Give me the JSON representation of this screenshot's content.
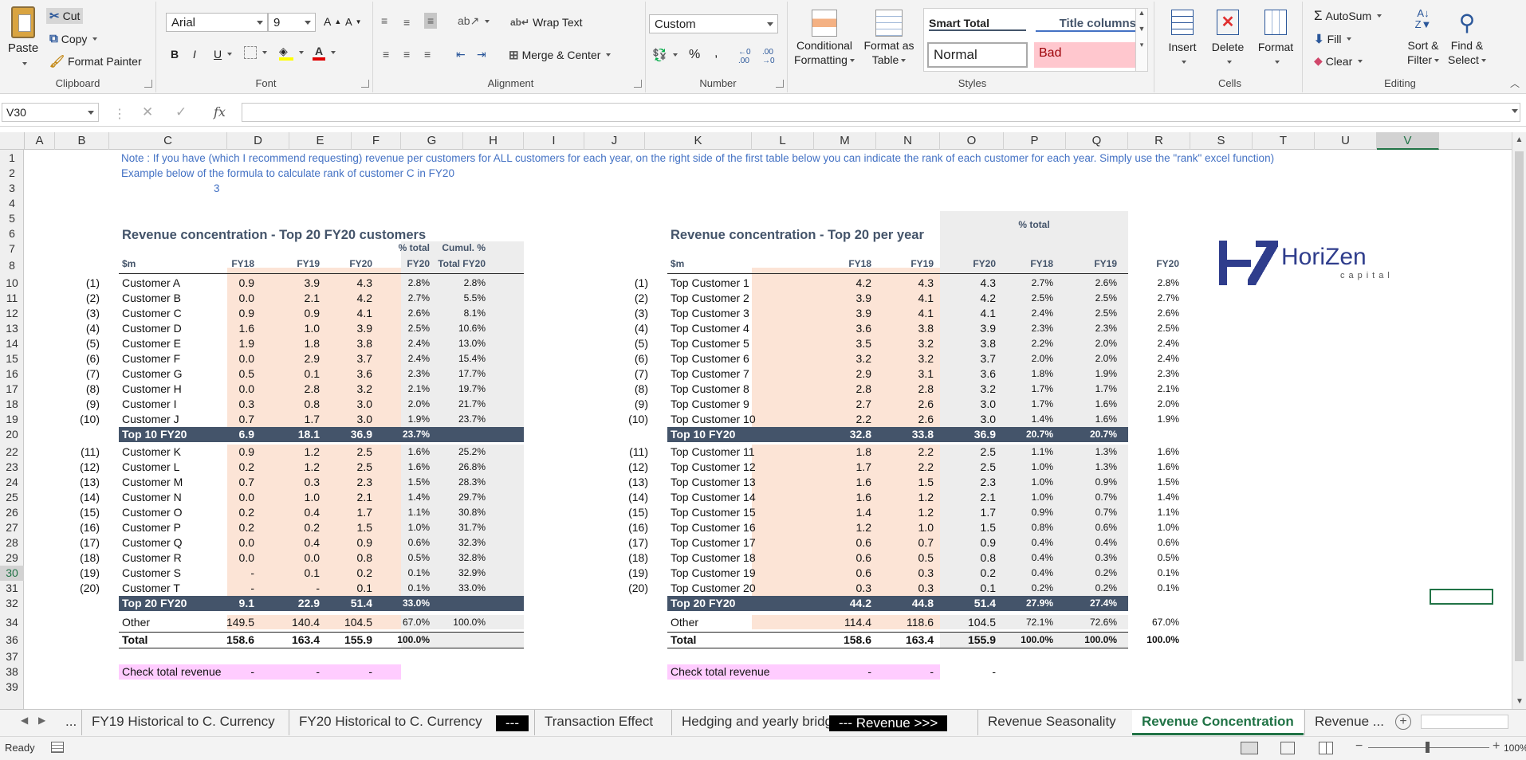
{
  "ribbon": {
    "clipboard": {
      "label": "Clipboard",
      "paste": "Paste",
      "cut": "Cut",
      "copy": "Copy",
      "format_painter": "Format Painter"
    },
    "font": {
      "label": "Font",
      "name": "Arial",
      "size": "9"
    },
    "alignment": {
      "label": "Alignment",
      "wrap": "Wrap Text",
      "merge": "Merge & Center"
    },
    "number": {
      "label": "Number",
      "format": "Custom"
    },
    "styles": {
      "label": "Styles",
      "cond1": "Conditional",
      "cond2": "Formatting",
      "fmt1": "Format as",
      "fmt2": "Table",
      "smart_total": "Smart Total",
      "title_columns": "Title columns",
      "normal": "Normal",
      "bad": "Bad"
    },
    "cells": {
      "label": "Cells",
      "insert": "Insert",
      "delete": "Delete",
      "format": "Format"
    },
    "editing": {
      "label": "Editing",
      "autosum": "AutoSum",
      "fill": "Fill",
      "clear": "Clear",
      "sort1": "Sort &",
      "sort2": "Filter",
      "find1": "Find &",
      "find2": "Select"
    }
  },
  "formula_bar": {
    "name_box": "V30",
    "fx": "fx",
    "content": ""
  },
  "columns": [
    "A",
    "B",
    "C",
    "D",
    "E",
    "F",
    "G",
    "H",
    "I",
    "J",
    "K",
    "L",
    "M",
    "N",
    "O",
    "P",
    "Q",
    "R",
    "S",
    "T",
    "U",
    "V"
  ],
  "rows": [
    "1",
    "2",
    "3",
    "4",
    "5",
    "6",
    "7",
    "8",
    "10",
    "11",
    "12",
    "13",
    "14",
    "15",
    "16",
    "17",
    "18",
    "19",
    "20",
    "22",
    "23",
    "24",
    "25",
    "26",
    "27",
    "28",
    "29",
    "30",
    "31",
    "32",
    "34",
    "36",
    "37",
    "38",
    "39"
  ],
  "sheet": {
    "note1": "Note : If you have (which I recommend requesting) revenue per customers for ALL customers for each year, on the right side of the first table below you can indicate the rank of each customer for each year. Simply use the \"rank\" excel function)",
    "note2": "Example below of the formula to calculate rank of customer C in FY20",
    "note3": "3",
    "left": {
      "title": "Revenue concentration - Top 20 FY20 customers",
      "unit": "$m",
      "h_fy18": "FY18",
      "h_fy19": "FY19",
      "h_fy20": "FY20",
      "h_pct1": "% total",
      "h_pct2": "FY20",
      "h_cum1": "Cumul. %",
      "h_cum2": "Total FY20",
      "rows": [
        {
          "rank": "(1)",
          "name": "Customer A",
          "fy18": "0.9",
          "fy19": "3.9",
          "fy20": "4.3",
          "pct": "2.8%",
          "cum": "2.8%"
        },
        {
          "rank": "(2)",
          "name": "Customer B",
          "fy18": "0.0",
          "fy19": "2.1",
          "fy20": "4.2",
          "pct": "2.7%",
          "cum": "5.5%"
        },
        {
          "rank": "(3)",
          "name": "Customer C",
          "fy18": "0.9",
          "fy19": "0.9",
          "fy20": "4.1",
          "pct": "2.6%",
          "cum": "8.1%"
        },
        {
          "rank": "(4)",
          "name": "Customer D",
          "fy18": "1.6",
          "fy19": "1.0",
          "fy20": "3.9",
          "pct": "2.5%",
          "cum": "10.6%"
        },
        {
          "rank": "(5)",
          "name": "Customer E",
          "fy18": "1.9",
          "fy19": "1.8",
          "fy20": "3.8",
          "pct": "2.4%",
          "cum": "13.0%"
        },
        {
          "rank": "(6)",
          "name": "Customer F",
          "fy18": "0.0",
          "fy19": "2.9",
          "fy20": "3.7",
          "pct": "2.4%",
          "cum": "15.4%"
        },
        {
          "rank": "(7)",
          "name": "Customer G",
          "fy18": "0.5",
          "fy19": "0.1",
          "fy20": "3.6",
          "pct": "2.3%",
          "cum": "17.7%"
        },
        {
          "rank": "(8)",
          "name": "Customer H",
          "fy18": "0.0",
          "fy19": "2.8",
          "fy20": "3.2",
          "pct": "2.1%",
          "cum": "19.7%"
        },
        {
          "rank": "(9)",
          "name": "Customer I",
          "fy18": "0.3",
          "fy19": "0.8",
          "fy20": "3.0",
          "pct": "2.0%",
          "cum": "21.7%"
        },
        {
          "rank": "(10)",
          "name": "Customer J",
          "fy18": "0.7",
          "fy19": "1.7",
          "fy20": "3.0",
          "pct": "1.9%",
          "cum": "23.7%"
        }
      ],
      "top10": {
        "label": "Top 10 FY20",
        "fy18": "6.9",
        "fy19": "18.1",
        "fy20": "36.9",
        "pct": "23.7%"
      },
      "rows2": [
        {
          "rank": "(11)",
          "name": "Customer K",
          "fy18": "0.9",
          "fy19": "1.2",
          "fy20": "2.5",
          "pct": "1.6%",
          "cum": "25.2%"
        },
        {
          "rank": "(12)",
          "name": "Customer L",
          "fy18": "0.2",
          "fy19": "1.2",
          "fy20": "2.5",
          "pct": "1.6%",
          "cum": "26.8%"
        },
        {
          "rank": "(13)",
          "name": "Customer M",
          "fy18": "0.7",
          "fy19": "0.3",
          "fy20": "2.3",
          "pct": "1.5%",
          "cum": "28.3%"
        },
        {
          "rank": "(14)",
          "name": "Customer N",
          "fy18": "0.0",
          "fy19": "1.0",
          "fy20": "2.1",
          "pct": "1.4%",
          "cum": "29.7%"
        },
        {
          "rank": "(15)",
          "name": "Customer O",
          "fy18": "0.2",
          "fy19": "0.4",
          "fy20": "1.7",
          "pct": "1.1%",
          "cum": "30.8%"
        },
        {
          "rank": "(16)",
          "name": "Customer P",
          "fy18": "0.2",
          "fy19": "0.2",
          "fy20": "1.5",
          "pct": "1.0%",
          "cum": "31.7%"
        },
        {
          "rank": "(17)",
          "name": "Customer Q",
          "fy18": "0.0",
          "fy19": "0.4",
          "fy20": "0.9",
          "pct": "0.6%",
          "cum": "32.3%"
        },
        {
          "rank": "(18)",
          "name": "Customer R",
          "fy18": "0.0",
          "fy19": "0.0",
          "fy20": "0.8",
          "pct": "0.5%",
          "cum": "32.8%"
        },
        {
          "rank": "(19)",
          "name": "Customer S",
          "fy18": "-",
          "fy19": "0.1",
          "fy20": "0.2",
          "pct": "0.1%",
          "cum": "32.9%"
        },
        {
          "rank": "(20)",
          "name": "Customer T",
          "fy18": "-",
          "fy19": "-",
          "fy20": "0.1",
          "pct": "0.1%",
          "cum": "33.0%"
        }
      ],
      "top20": {
        "label": "Top 20 FY20",
        "fy18": "9.1",
        "fy19": "22.9",
        "fy20": "51.4",
        "pct": "33.0%"
      },
      "other": {
        "label": "Other",
        "fy18": "149.5",
        "fy19": "140.4",
        "fy20": "104.5",
        "pct": "67.0%",
        "cum": "100.0%"
      },
      "total": {
        "label": "Total",
        "fy18": "158.6",
        "fy19": "163.4",
        "fy20": "155.9",
        "pct": "100.0%"
      },
      "check": {
        "label": "Check total revenue",
        "fy18": "-",
        "fy19": "-",
        "fy20": "-"
      }
    },
    "right": {
      "title": "Revenue concentration - Top 20 per year",
      "pct_total": "% total",
      "unit": "$m",
      "h_fy18": "FY18",
      "h_fy19": "FY19",
      "h_fy20": "FY20",
      "p_fy18": "FY18",
      "p_fy19": "FY19",
      "p_fy20": "FY20",
      "rows": [
        {
          "rank": "(1)",
          "name": "Top Customer 1",
          "fy18": "4.2",
          "fy19": "4.3",
          "fy20": "4.3",
          "p18": "2.7%",
          "p19": "2.6%",
          "p20": "2.8%"
        },
        {
          "rank": "(2)",
          "name": "Top Customer 2",
          "fy18": "3.9",
          "fy19": "4.1",
          "fy20": "4.2",
          "p18": "2.5%",
          "p19": "2.5%",
          "p20": "2.7%"
        },
        {
          "rank": "(3)",
          "name": "Top Customer 3",
          "fy18": "3.9",
          "fy19": "4.1",
          "fy20": "4.1",
          "p18": "2.4%",
          "p19": "2.5%",
          "p20": "2.6%"
        },
        {
          "rank": "(4)",
          "name": "Top Customer 4",
          "fy18": "3.6",
          "fy19": "3.8",
          "fy20": "3.9",
          "p18": "2.3%",
          "p19": "2.3%",
          "p20": "2.5%"
        },
        {
          "rank": "(5)",
          "name": "Top Customer 5",
          "fy18": "3.5",
          "fy19": "3.2",
          "fy20": "3.8",
          "p18": "2.2%",
          "p19": "2.0%",
          "p20": "2.4%"
        },
        {
          "rank": "(6)",
          "name": "Top Customer 6",
          "fy18": "3.2",
          "fy19": "3.2",
          "fy20": "3.7",
          "p18": "2.0%",
          "p19": "2.0%",
          "p20": "2.4%"
        },
        {
          "rank": "(7)",
          "name": "Top Customer 7",
          "fy18": "2.9",
          "fy19": "3.1",
          "fy20": "3.6",
          "p18": "1.8%",
          "p19": "1.9%",
          "p20": "2.3%"
        },
        {
          "rank": "(8)",
          "name": "Top Customer 8",
          "fy18": "2.8",
          "fy19": "2.8",
          "fy20": "3.2",
          "p18": "1.7%",
          "p19": "1.7%",
          "p20": "2.1%"
        },
        {
          "rank": "(9)",
          "name": "Top Customer 9",
          "fy18": "2.7",
          "fy19": "2.6",
          "fy20": "3.0",
          "p18": "1.7%",
          "p19": "1.6%",
          "p20": "2.0%"
        },
        {
          "rank": "(10)",
          "name": "Top Customer 10",
          "fy18": "2.2",
          "fy19": "2.6",
          "fy20": "3.0",
          "p18": "1.4%",
          "p19": "1.6%",
          "p20": "1.9%"
        }
      ],
      "top10": {
        "label": "Top 10 FY20",
        "fy18": "32.8",
        "fy19": "33.8",
        "fy20": "36.9",
        "p18": "20.7%",
        "p19": "20.7%",
        "p20": "23.7%"
      },
      "rows2": [
        {
          "rank": "(11)",
          "name": "Top Customer 11",
          "fy18": "1.8",
          "fy19": "2.2",
          "fy20": "2.5",
          "p18": "1.1%",
          "p19": "1.3%",
          "p20": "1.6%"
        },
        {
          "rank": "(12)",
          "name": "Top Customer 12",
          "fy18": "1.7",
          "fy19": "2.2",
          "fy20": "2.5",
          "p18": "1.0%",
          "p19": "1.3%",
          "p20": "1.6%"
        },
        {
          "rank": "(13)",
          "name": "Top Customer 13",
          "fy18": "1.6",
          "fy19": "1.5",
          "fy20": "2.3",
          "p18": "1.0%",
          "p19": "0.9%",
          "p20": "1.5%"
        },
        {
          "rank": "(14)",
          "name": "Top Customer 14",
          "fy18": "1.6",
          "fy19": "1.2",
          "fy20": "2.1",
          "p18": "1.0%",
          "p19": "0.7%",
          "p20": "1.4%"
        },
        {
          "rank": "(15)",
          "name": "Top Customer 15",
          "fy18": "1.4",
          "fy19": "1.2",
          "fy20": "1.7",
          "p18": "0.9%",
          "p19": "0.7%",
          "p20": "1.1%"
        },
        {
          "rank": "(16)",
          "name": "Top Customer 16",
          "fy18": "1.2",
          "fy19": "1.0",
          "fy20": "1.5",
          "p18": "0.8%",
          "p19": "0.6%",
          "p20": "1.0%"
        },
        {
          "rank": "(17)",
          "name": "Top Customer 17",
          "fy18": "0.6",
          "fy19": "0.7",
          "fy20": "0.9",
          "p18": "0.4%",
          "p19": "0.4%",
          "p20": "0.6%"
        },
        {
          "rank": "(18)",
          "name": "Top Customer 18",
          "fy18": "0.6",
          "fy19": "0.5",
          "fy20": "0.8",
          "p18": "0.4%",
          "p19": "0.3%",
          "p20": "0.5%"
        },
        {
          "rank": "(19)",
          "name": "Top Customer 19",
          "fy18": "0.6",
          "fy19": "0.3",
          "fy20": "0.2",
          "p18": "0.4%",
          "p19": "0.2%",
          "p20": "0.1%"
        },
        {
          "rank": "(20)",
          "name": "Top Customer 20",
          "fy18": "0.3",
          "fy19": "0.3",
          "fy20": "0.1",
          "p18": "0.2%",
          "p19": "0.2%",
          "p20": "0.1%"
        }
      ],
      "top20": {
        "label": "Top 20 FY20",
        "fy18": "44.2",
        "fy19": "44.8",
        "fy20": "51.4",
        "p18": "27.9%",
        "p19": "27.4%",
        "p20": "33.0%"
      },
      "other": {
        "label": "Other",
        "fy18": "114.4",
        "fy19": "118.6",
        "fy20": "104.5",
        "p18": "72.1%",
        "p19": "72.6%",
        "p20": "67.0%"
      },
      "total": {
        "label": "Total",
        "fy18": "158.6",
        "fy19": "163.4",
        "fy20": "155.9",
        "p18": "100.0%",
        "p19": "100.0%",
        "p20": "100.0%"
      },
      "check": {
        "label": "Check total revenue",
        "fy18": "-",
        "fy19": "-",
        "fy20": "-"
      }
    },
    "logo": {
      "name": "HoriZen",
      "sub": "capital"
    }
  },
  "tabs": [
    {
      "label": "...",
      "style": "plain"
    },
    {
      "label": "FY19 Historical to C. Currency",
      "style": "plain"
    },
    {
      "label": "FY20 Historical to C. Currency",
      "style": "plain"
    },
    {
      "label": "---",
      "style": "black"
    },
    {
      "label": "Transaction Effect",
      "style": "plain"
    },
    {
      "label": "Hedging and yearly bridge",
      "style": "plain"
    },
    {
      "label": "--- Revenue >>>",
      "style": "black"
    },
    {
      "label": "Revenue Seasonality",
      "style": "plain"
    },
    {
      "label": "Revenue Concentration",
      "style": "active"
    },
    {
      "label": "Revenue ...",
      "style": "plain"
    }
  ],
  "status": {
    "ready": "Ready",
    "zoom": "100%"
  },
  "colors": {
    "accent": "#217346",
    "peach": "#fce4d6",
    "navy": "#44546a",
    "note_blue": "#4472c4",
    "pink": "#ffccff",
    "grey": "#ededed"
  }
}
